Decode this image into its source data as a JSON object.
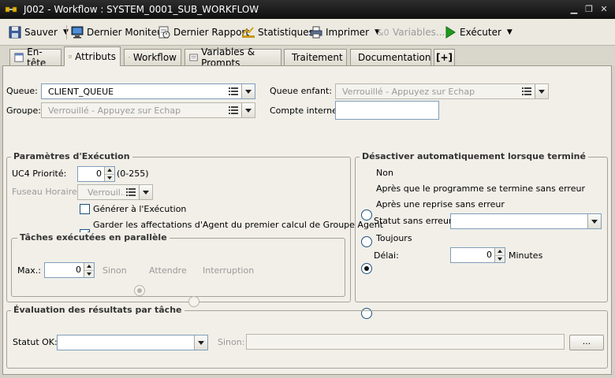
{
  "window": {
    "title": "J002 - Workflow : SYSTEM_0001_SUB_WORKFLOW"
  },
  "toolbar": {
    "save": "Sauver",
    "last_monitor": "Dernier Moniteur",
    "last_report": "Dernier Rapport",
    "statistics": "Statistiques",
    "print": "Imprimer",
    "variables": "Variables...",
    "execute": "Exécuter"
  },
  "tabs": [
    {
      "label": "En-tête"
    },
    {
      "label": "Attributs"
    },
    {
      "label": "Workflow"
    },
    {
      "label": "Variables & Prompts"
    },
    {
      "label": "Traitement"
    },
    {
      "label": "Documentation"
    },
    {
      "label": "[+]"
    }
  ],
  "queue": {
    "label": "Queue:",
    "value": "CLIENT_QUEUE"
  },
  "group": {
    "label": "Groupe:",
    "value": "Verrouillé - Appuyez sur Echap"
  },
  "child_queue": {
    "label": "Queue enfant:",
    "value": "Verrouillé - Appuyez sur Echap"
  },
  "internal_account": {
    "label": "Compte interne:",
    "value": ""
  },
  "exec_params": {
    "title": "Paramètres d'Exécution",
    "priority_label": "UC4 Priorité:",
    "priority_value": "0",
    "priority_range": "(0-255)",
    "timezone_label": "Fuseau Horaire:",
    "timezone_value": "Verrouil...",
    "generate_label": "Générer à l'Exécution",
    "generate_checked": false,
    "keep_label": "Garder les affectations d'Agent du premier calcul de Groupe Agent",
    "keep_checked": true
  },
  "parallel": {
    "title": "Tâches exécutées en parallèle",
    "max_label": "Max.:",
    "max_value": "0",
    "else_label": "Sinon",
    "wait_label": "Attendre",
    "interrupt_label": "Interruption"
  },
  "deactivate": {
    "title": "Désactiver automatiquement lorsque terminé",
    "opt_none": "Non",
    "opt_after_program": "Après que le programme se termine sans erreur",
    "opt_after_restart": "Après une reprise sans erreur",
    "selected": "opt_after_restart",
    "status_label": "Statut sans erreur:",
    "status_value": "",
    "opt_always": "Toujours",
    "delay_label": "Délai:",
    "delay_value": "0",
    "delay_unit": "Minutes"
  },
  "evaluation": {
    "title": "Évaluation des résultats par tâche",
    "status_ok_label": "Statut OK:",
    "status_ok_value": "",
    "else_label": "Sinon:",
    "else_value": "",
    "browse_label": "..."
  },
  "colors": {
    "titlebar": "#1a1a1a",
    "panel": "#f1efe8",
    "field_border": "#7f9db9",
    "execute_green": "#1e9a1e"
  }
}
